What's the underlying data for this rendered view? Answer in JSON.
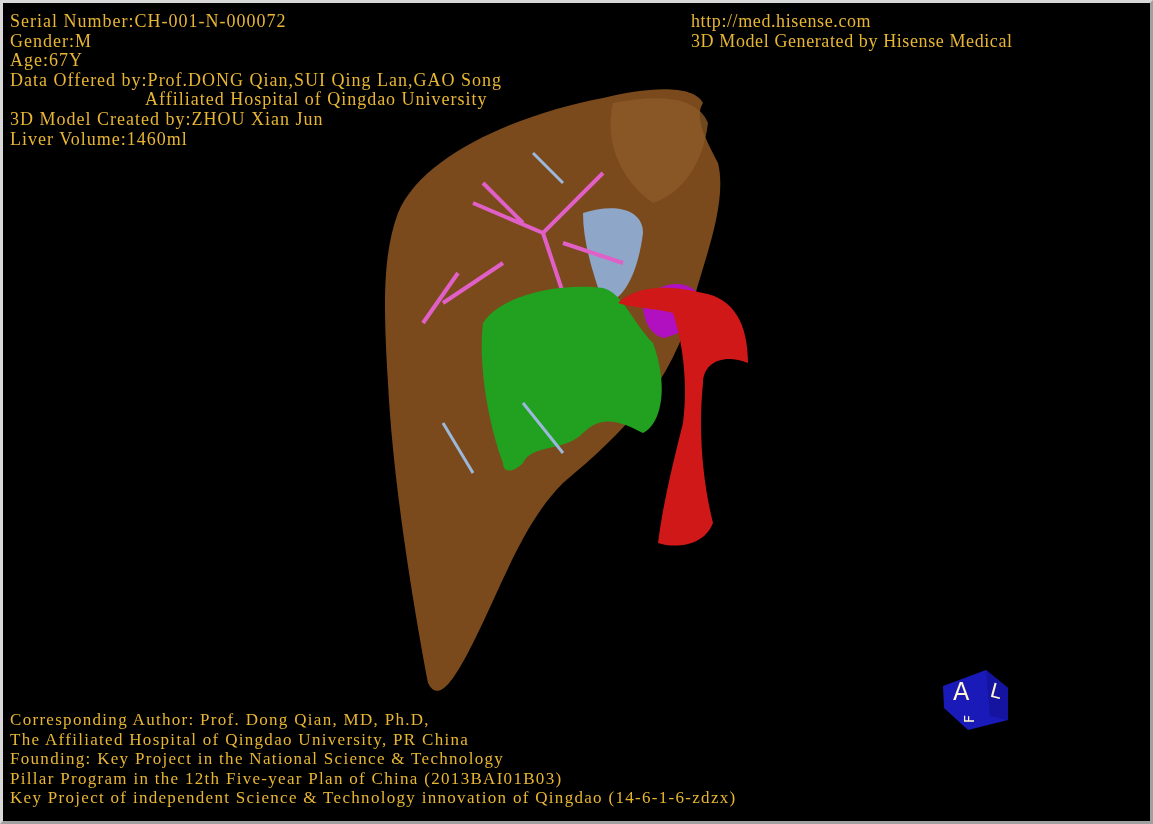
{
  "patient_info": [
    {
      "text": "Serial Number:CH-001-N-000072",
      "indented": false
    },
    {
      "text": "Gender:M",
      "indented": false
    },
    {
      "text": "Age:67Y",
      "indented": false
    },
    {
      "text": "Data Offered by:Prof.DONG Qian,SUI Qing Lan,GAO Song",
      "indented": false
    },
    {
      "text": "Affiliated Hospital of Qingdao University",
      "indented": true
    },
    {
      "text": "3D Model Created by:ZHOU Xian Jun",
      "indented": false
    },
    {
      "text": "Liver Volume:1460ml",
      "indented": false
    }
  ],
  "vendor_info": [
    "http://med.hisense.com",
    "3D Model Generated by Hisense Medical"
  ],
  "credits": [
    "Corresponding Author: Prof. Dong Qian, MD, Ph.D,",
    "The Affiliated Hospital of Qingdao University, PR China",
    "Founding: Key Project in the National Science & Technology",
    "Pillar Program in the 12th Five-year Plan of China (2013BAI01B03)",
    "Key Project of independent Science & Technology innovation of Qingdao (14-6-1-6-zdzx)"
  ],
  "orientation_cube": {
    "front": "A",
    "side": "L",
    "bottom": "F"
  }
}
